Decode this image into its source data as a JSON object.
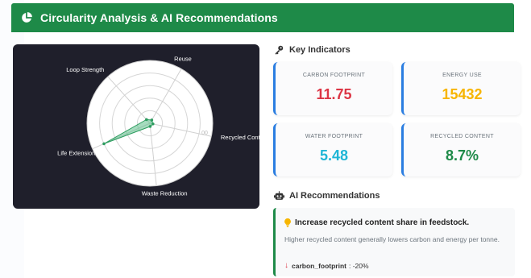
{
  "header": {
    "title": "Circularity Analysis & AI Recommendations",
    "icon": "pie-chart-icon",
    "color": "#1e8a48"
  },
  "radar": {
    "axes": [
      "Reuse",
      "Recycled Cont",
      "Waste Reduction",
      "Life Extension",
      "Loop Strength"
    ],
    "scale_label_fragment": "00",
    "values": [
      0.06,
      0.05,
      0.05,
      0.8,
      0.08
    ],
    "fill_color": "#5cc08a",
    "background": "#1f1f2b"
  },
  "indicators": {
    "title": "Key Indicators",
    "icon": "key-icon",
    "items": [
      {
        "label": "CARBON FOOTPRINT",
        "value": "11.75",
        "color": "#dc3545",
        "accent": "#2a7de1"
      },
      {
        "label": "ENERGY USE",
        "value": "15432",
        "color": "#f7b500",
        "accent": "#2a7de1"
      },
      {
        "label": "WATER FOOTPRINT",
        "value": "5.48",
        "color": "#1fb6d6",
        "accent": "#2a7de1"
      },
      {
        "label": "RECYCLED CONTENT",
        "value": "8.7%",
        "color": "#1e8a48",
        "accent": "#2a7de1"
      }
    ]
  },
  "recommendations": {
    "title": "AI Recommendations",
    "icon": "robot-icon",
    "items": [
      {
        "icon": "lightbulb-icon",
        "title": "Increase recycled content share in feedstock.",
        "description": "Higher recycled content generally lowers carbon and energy per tonne.",
        "impact_metric": "carbon_footprint",
        "impact_value": ": -20%"
      }
    ]
  }
}
